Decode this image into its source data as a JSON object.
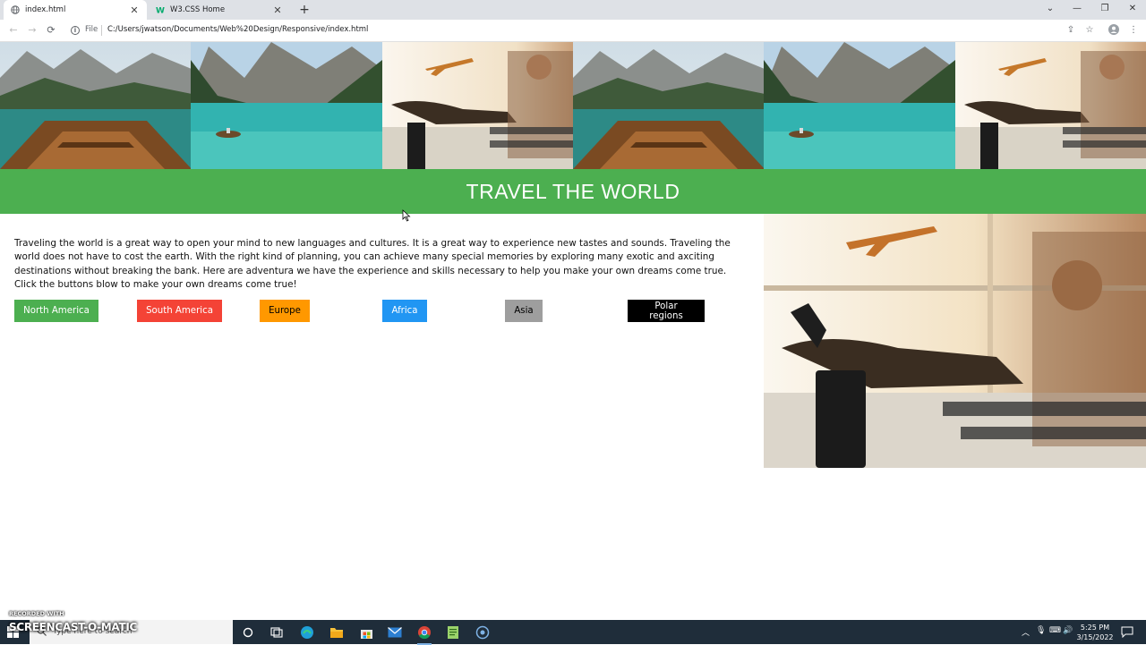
{
  "browser": {
    "tabs": [
      {
        "title": "index.html",
        "active": true
      },
      {
        "title": "W3.CSS Home",
        "active": false
      }
    ],
    "url_scheme": "File",
    "url": "C:/Users/jwatson/Documents/Web%20Design/Responsive/index.html"
  },
  "page": {
    "banner_images": [
      "lake-boat-photo",
      "lake-rowboat-photo",
      "airport-traveler-photo",
      "lake-boat-photo",
      "lake-rowboat-photo",
      "airport-traveler-photo"
    ],
    "headline": "TRAVEL THE WORLD",
    "intro": "Traveling the world is a great way to open your mind to new languages and cultures. It is a great way to experience new tastes and sounds. Traveling the world does not have to cost the earth. With the right kind of planning, you can achieve many special memories by exploring many exotic and axciting destinations without breaking the bank. Here are adventura we have the experience and skills necessary to help you make your own dreams come true. Click the buttons blow to make your own dreams come true!",
    "buttons": [
      {
        "label": "North America",
        "bg": "#4caf50",
        "fg": "#ffffff"
      },
      {
        "label": "South America",
        "bg": "#f44336",
        "fg": "#ffffff"
      },
      {
        "label": "Europe",
        "bg": "#ff9800",
        "fg": "#000000"
      },
      {
        "label": "Africa",
        "bg": "#2196f3",
        "fg": "#ffffff"
      },
      {
        "label": "Asia",
        "bg": "#9e9e9e",
        "fg": "#000000"
      },
      {
        "label": "Polar regions",
        "bg": "#000000",
        "fg": "#ffffff"
      }
    ],
    "accent": "#4caf50"
  },
  "taskbar": {
    "search_placeholder": "Type here to search",
    "time": "5:25 PM",
    "date": "3/15/2022"
  },
  "watermark": {
    "top": "RECORDED WITH",
    "brand": "SCREENCAST-O-MATIC"
  }
}
